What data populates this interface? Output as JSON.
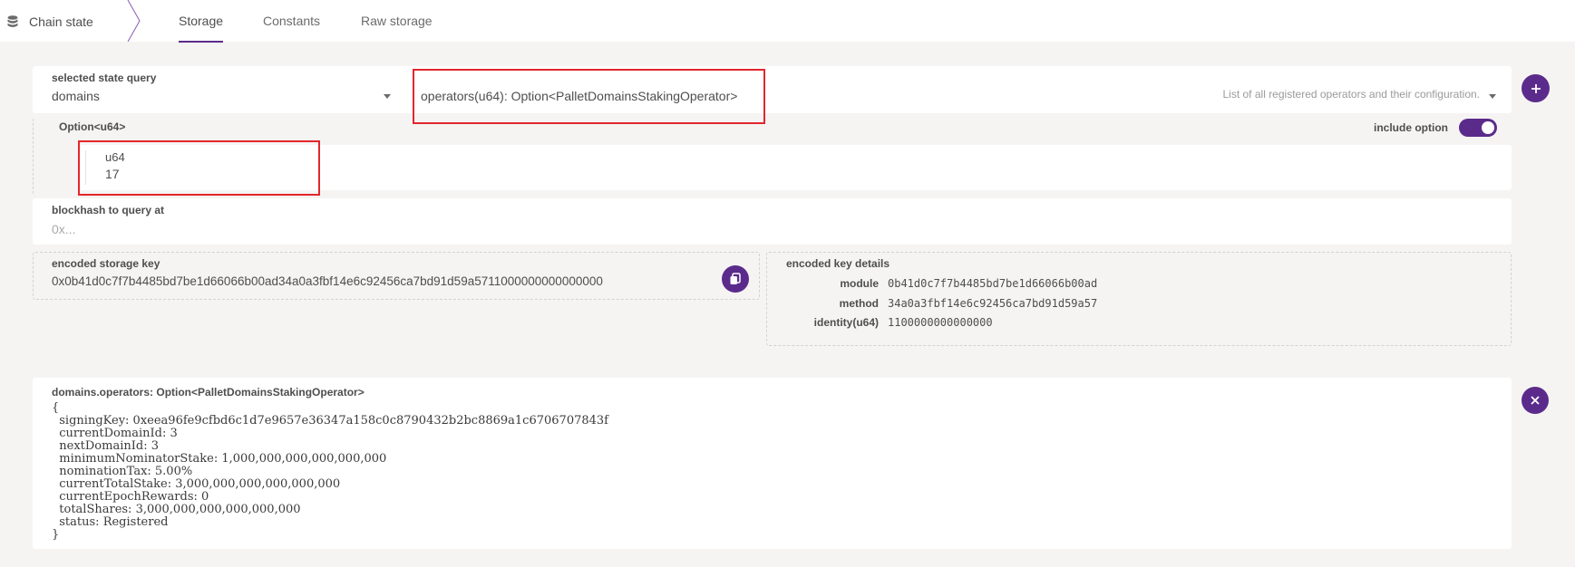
{
  "app": {
    "section_title": "Chain state"
  },
  "tabs": [
    {
      "label": "Storage",
      "active": true
    },
    {
      "label": "Constants",
      "active": false
    },
    {
      "label": "Raw storage",
      "active": false
    }
  ],
  "query": {
    "selected_label": "selected state query",
    "module": "domains",
    "method": "operators(u64): Option<PalletDomainsStakingOperator>",
    "description": "List of all registered operators and their configuration."
  },
  "option": {
    "label": "Option<u64>",
    "include_label": "include option",
    "include_enabled": true,
    "param_label": "u64",
    "param_value": "17"
  },
  "blockhash": {
    "label": "blockhash to query at",
    "placeholder": "0x..."
  },
  "encoded": {
    "label": "encoded storage key",
    "value": "0x0b41d0c7f7b4485bd7be1d66066b00ad34a0a3fbf14e6c92456ca7bd91d59a5711000000000000000"
  },
  "key_details": {
    "label": "encoded key details",
    "rows": [
      {
        "key": "module",
        "value": "0b41d0c7f7b4485bd7be1d66066b00ad"
      },
      {
        "key": "method",
        "value": "34a0a3fbf14e6c92456ca7bd91d59a57"
      },
      {
        "key": "identity(u64)",
        "value": "1100000000000000"
      }
    ]
  },
  "result": {
    "title": "domains.operators: Option<PalletDomainsStakingOperator>",
    "body": "{\n  signingKey: 0xeea96fe9cfbd6c1d7e9657e36347a158c0c8790432b2bc8869a1c6706707843f\n  currentDomainId: 3\n  nextDomainId: 3\n  minimumNominatorStake: 1,000,000,000,000,000,000\n  nominationTax: 5.00%\n  currentTotalStake: 3,000,000,000,000,000,000\n  currentEpochRewards: 0\n  totalShares: 3,000,000,000,000,000,000\n  status: Registered\n}"
  },
  "colors": {
    "accent": "#5b2b8c",
    "highlight": "#e3262d"
  }
}
